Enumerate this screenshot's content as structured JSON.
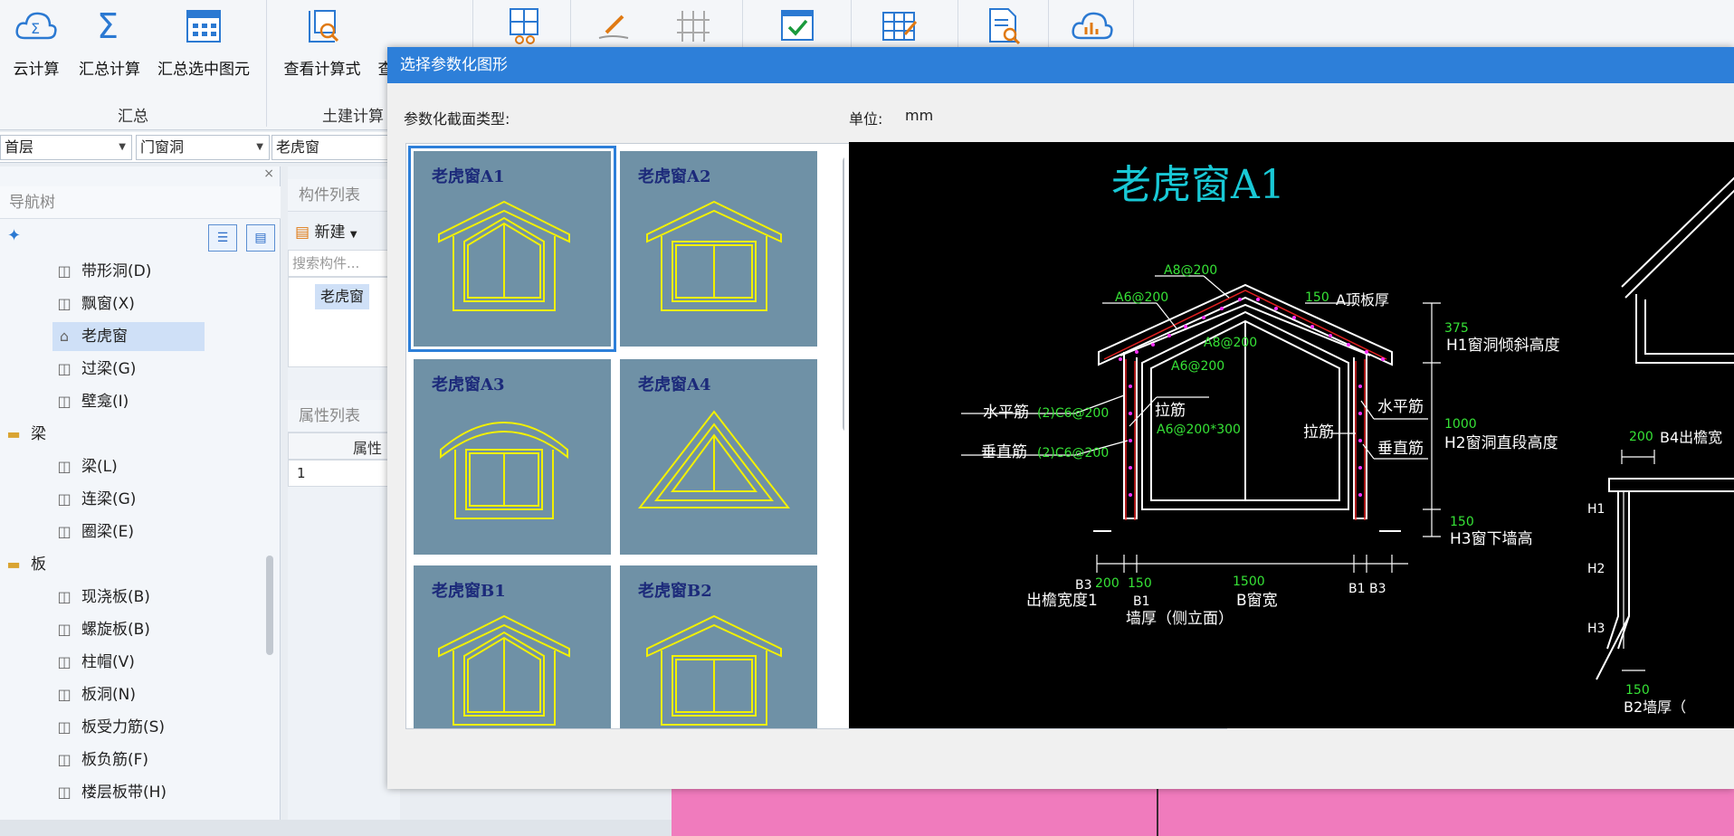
{
  "ribbon": {
    "buttons": [
      {
        "label": "云计算",
        "icon": "cloud-sigma-icon"
      },
      {
        "label": "汇总计算",
        "icon": "sigma-icon"
      },
      {
        "label": "汇总选中图元",
        "icon": "calculator-icon"
      },
      {
        "label": "查看计算式",
        "icon": "formula-search-icon"
      },
      {
        "label": "查",
        "icon": "table-search-icon"
      }
    ],
    "extra_icons": [
      "grid-glasses-icon",
      "pencil-icon",
      "rebar-grid-icon",
      "check-icon",
      "table-edit-icon",
      "doc-search-icon",
      "cloud-chart-icon"
    ],
    "groups": {
      "summary": "汇总",
      "civil": "土建计算"
    }
  },
  "dropdowns": {
    "floor": "首层",
    "category": "门窗洞",
    "component": "老虎窗"
  },
  "nav": {
    "close": "×",
    "title": "导航树",
    "add_icon": "add-sparkle-icon",
    "items": [
      {
        "label": "带形洞(D)",
        "icon": "strip-opening-icon",
        "type": "item"
      },
      {
        "label": "飘窗(X)",
        "icon": "bay-window-icon",
        "type": "item"
      },
      {
        "label": "老虎窗",
        "icon": "dormer-icon",
        "type": "item",
        "selected": true
      },
      {
        "label": "过梁(G)",
        "icon": "lintel-icon",
        "type": "item"
      },
      {
        "label": "壁龛(I)",
        "icon": "niche-icon",
        "type": "item"
      },
      {
        "label": "梁",
        "icon": "folder-icon",
        "type": "folder"
      },
      {
        "label": "梁(L)",
        "icon": "beam-icon",
        "type": "item"
      },
      {
        "label": "连梁(G)",
        "icon": "coupling-beam-icon",
        "type": "item"
      },
      {
        "label": "圈梁(E)",
        "icon": "ring-beam-icon",
        "type": "item"
      },
      {
        "label": "板",
        "icon": "folder-icon",
        "type": "folder"
      },
      {
        "label": "现浇板(B)",
        "icon": "cast-slab-icon",
        "type": "item"
      },
      {
        "label": "螺旋板(B)",
        "icon": "spiral-slab-icon",
        "type": "item"
      },
      {
        "label": "柱帽(V)",
        "icon": "column-cap-icon",
        "type": "item"
      },
      {
        "label": "板洞(N)",
        "icon": "slab-hole-icon",
        "type": "item"
      },
      {
        "label": "板受力筋(S)",
        "icon": "slab-rebar-icon",
        "type": "item"
      },
      {
        "label": "板负筋(F)",
        "icon": "neg-rebar-icon",
        "type": "item"
      },
      {
        "label": "楼层板带(H)",
        "icon": "slab-strip-icon",
        "type": "item"
      }
    ]
  },
  "components": {
    "title": "构件列表",
    "new_label": "新建",
    "search_placeholder": "搜索构件...",
    "selected": "老虎窗"
  },
  "properties": {
    "title": "属性列表",
    "column": "属性",
    "row1": "1"
  },
  "dialog": {
    "title": "选择参数化图形",
    "type_label": "参数化截面类型:",
    "unit_label": "单位:",
    "unit": "mm",
    "thumbs": [
      "老虎窗A1",
      "老虎窗A2",
      "老虎窗A3",
      "老虎窗A4",
      "老虎窗B1",
      "老虎窗B2"
    ]
  },
  "cad": {
    "title": "老虎窗A1",
    "labels": {
      "a8": "A8@200",
      "a6_left": "A6@200",
      "a150": "150",
      "roof_thk": "A顶板厚",
      "a8_inner": "A8@200",
      "a6_inner": "A6@200",
      "h1_val": "375",
      "h1": "H1窗洞倾斜高度",
      "horiz_bar_l": "水平筋",
      "horiz_bar_l_val": "(2)C6@200",
      "tie": "拉筋",
      "tie_val": "A6@200*300",
      "vert_bar_l": "垂直筋",
      "vert_bar_l_val": "(2)C6@200",
      "tie_r": "拉筋",
      "horiz_bar_r": "水平筋",
      "vert_bar_r": "垂直筋",
      "h2_val": "1000",
      "h2": "H2窗洞直段高度",
      "h3_val": "150",
      "h3": "H3窗下墙高",
      "b3": "B3",
      "b200": "200",
      "b150": "150",
      "b1500": "1500",
      "b1b3": "B1 B3",
      "eave": "出檐宽度1",
      "b1": "B1",
      "bwidth": "B窗宽",
      "wall": "墙厚（侧立面）",
      "r200": "200",
      "b4": "B4出檐宽",
      "rh1": "H1",
      "rh2": "H2",
      "rh3": "H3",
      "r150": "150",
      "b2": "B2墙厚（"
    }
  }
}
